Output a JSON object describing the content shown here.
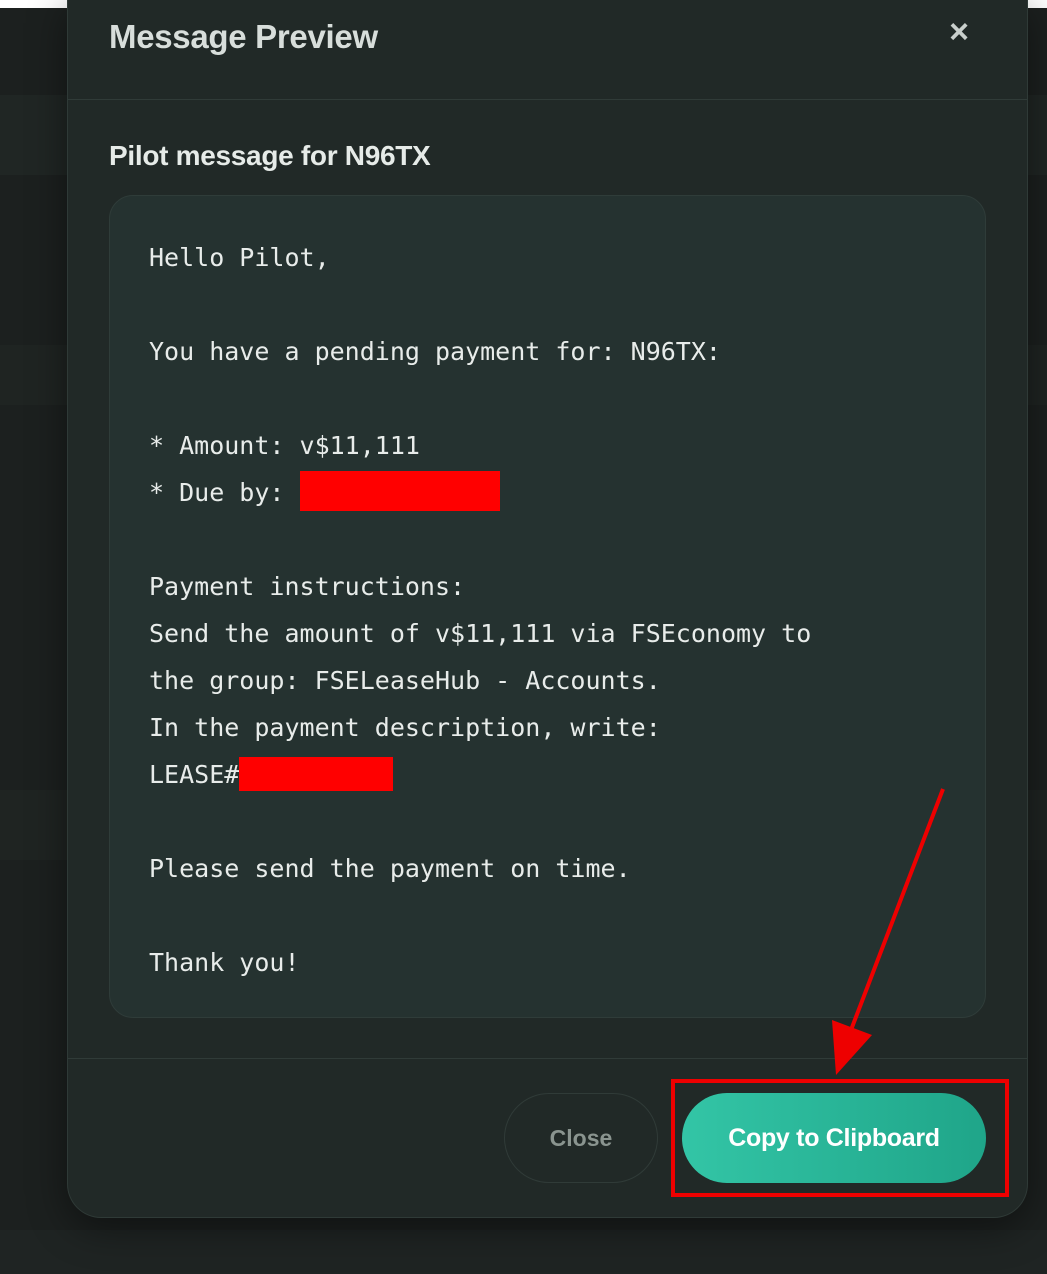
{
  "modal": {
    "title": "Message Preview",
    "close_icon": "×",
    "section_title": "Pilot message for N96TX",
    "message": {
      "lines": [
        "Hello Pilot,",
        "",
        "You have a pending payment for: N96TX:",
        "",
        "* Amount: v$11,111",
        "* Due by: ",
        "",
        "Payment instructions:",
        "Send the amount of v$11,111 via FSEconomy to",
        "the group: FSELeaseHub - Accounts.",
        "In the payment description, write:",
        "LEASE#",
        "",
        "Please send the payment on time.",
        "",
        "Thank you!"
      ]
    },
    "buttons": {
      "close_label": "Close",
      "copy_label": "Copy to Clipboard"
    }
  },
  "colors": {
    "accent": "#2bb89a",
    "annotation": "#ee0000",
    "redaction": "#ff0000"
  },
  "annotation": {
    "arrow_icon": "red-arrow",
    "highlight": "copy-button-highlight"
  }
}
